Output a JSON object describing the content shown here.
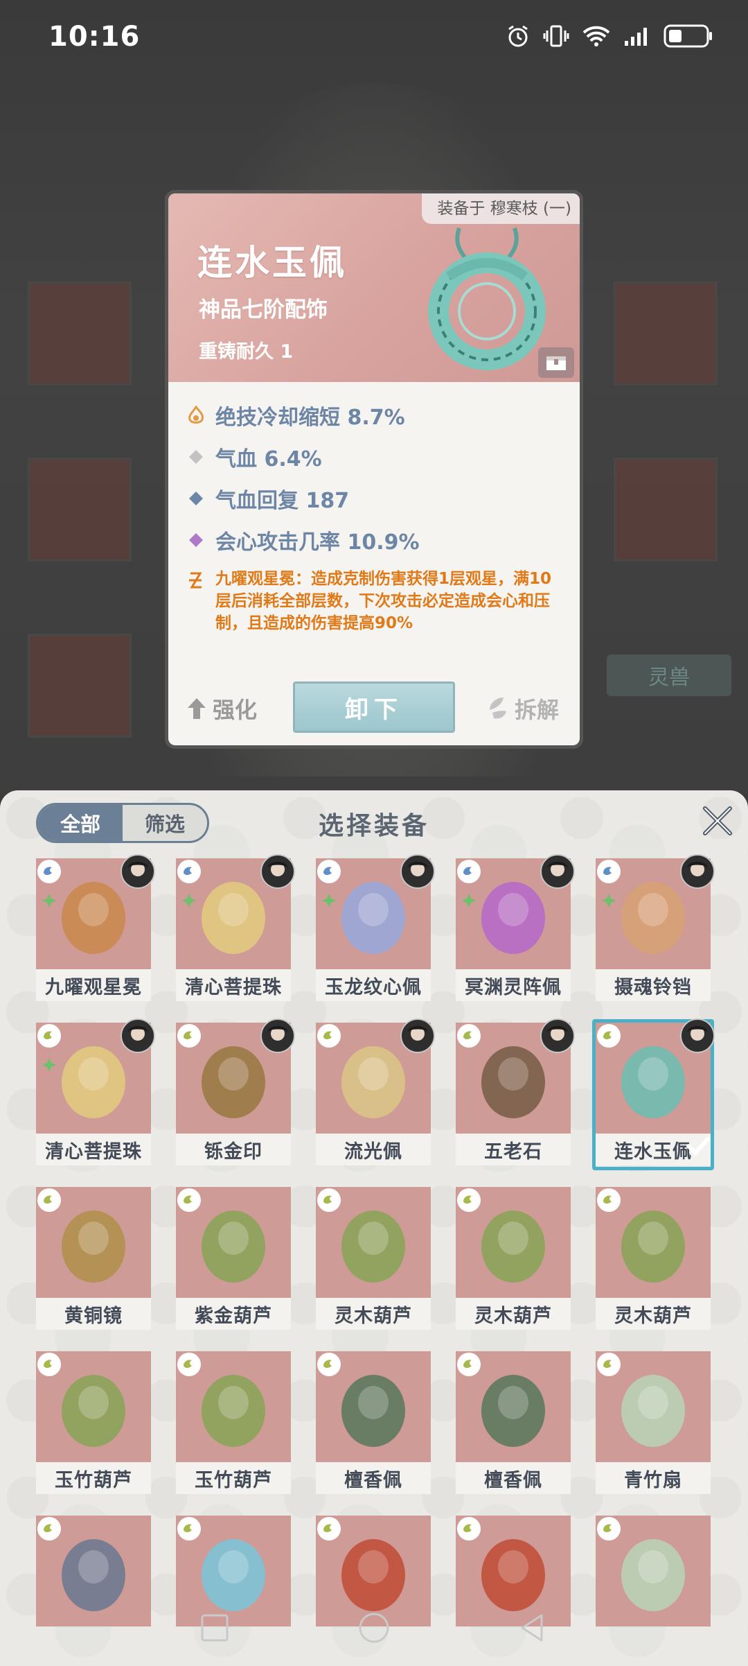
{
  "status_bar": {
    "time": "10:16"
  },
  "detail": {
    "equipped_on": "装备于 穆寒枝 (一)",
    "name": "连水玉佩",
    "grade": "神品七阶配饰",
    "durability": "重铸耐久 1",
    "stats": [
      {
        "icon": "flame-icon",
        "text": "绝技冷却缩短 8.7%"
      },
      {
        "icon": "gray-diamond-icon",
        "text": "气血 6.4%"
      },
      {
        "icon": "blue-diamond-icon",
        "text": "气血回复 187"
      },
      {
        "icon": "purple-diamond-icon",
        "text": "会心攻击几率 10.9%"
      }
    ],
    "special_effect": "九曜观星冕：造成克制伤害获得1层观星，满10层后消耗全部层数，下次攻击必定造成会心和压制，且造成的伤害提高90%",
    "enhance_label": "强化",
    "unequip_label": "卸下",
    "decompose_label": "拆解"
  },
  "background": {
    "tag_label": "灵兽"
  },
  "panel": {
    "tab_all": "全部",
    "tab_filter": "筛选",
    "title": "选择装备",
    "items": [
      {
        "name": "九曜观星冕"
      },
      {
        "name": "清心菩提珠"
      },
      {
        "name": "玉龙纹心佩"
      },
      {
        "name": "冥渊灵阵佩"
      },
      {
        "name": "摄魂铃铛"
      },
      {
        "name": "清心菩提珠"
      },
      {
        "name": "铄金印"
      },
      {
        "name": "流光佩"
      },
      {
        "name": "五老石"
      },
      {
        "name": "连水玉佩",
        "selected": true
      },
      {
        "name": "黄铜镜"
      },
      {
        "name": "紫金葫芦"
      },
      {
        "name": "灵木葫芦"
      },
      {
        "name": "灵木葫芦"
      },
      {
        "name": "灵木葫芦"
      },
      {
        "name": "玉竹葫芦"
      },
      {
        "name": "玉竹葫芦"
      },
      {
        "name": "檀香佩"
      },
      {
        "name": "檀香佩"
      },
      {
        "name": "青竹扇"
      },
      {
        "name": ""
      },
      {
        "name": ""
      },
      {
        "name": ""
      },
      {
        "name": ""
      },
      {
        "name": ""
      }
    ]
  },
  "colors": {
    "accent_teal": "#4ab0c6",
    "stat_blue": "#6d86a5",
    "special_orange": "#e07a18"
  }
}
